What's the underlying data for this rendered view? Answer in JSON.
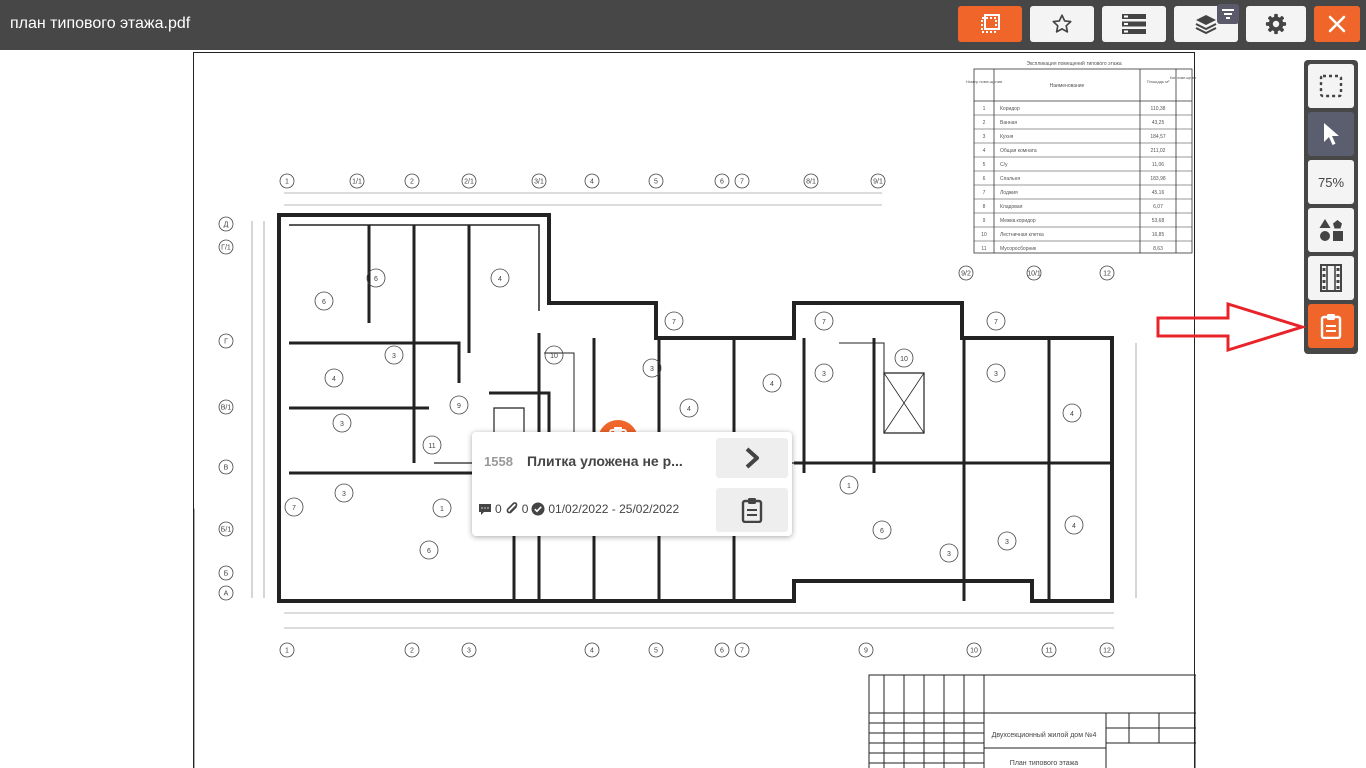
{
  "header": {
    "title": "план типового этажа.pdf"
  },
  "colors": {
    "accent": "#f0652a",
    "toolbar": "#474747",
    "active_tool": "#5b5e6e",
    "annotation_arrow": "#e8242a"
  },
  "toolbar": {
    "buttons": [
      "select-area-icon",
      "star-icon",
      "list-icon",
      "layers-icon",
      "gear-icon",
      "close-icon"
    ],
    "filter_badge": "filter-icon"
  },
  "side_toolbar": {
    "zoom_label": "75%",
    "tools": [
      "select-area-icon",
      "pointer-icon",
      "zoom",
      "shapes-icon",
      "film-icon",
      "clipboard-icon"
    ]
  },
  "task_popup": {
    "number": "1558",
    "title": "Плитка уложена не р...",
    "comments": "0",
    "attachments": "0",
    "dates": "01/02/2022 - 25/02/2022"
  },
  "drawing": {
    "explication_title": "Экспликация помещений типового этажа",
    "table_header": [
      "Номер поме-щения",
      "Наименование",
      "Площадь м²",
      "Кат. поме-ще-ния"
    ],
    "table_rows": [
      [
        "1",
        "Коридор",
        "110,38"
      ],
      [
        "2",
        "Ванная",
        "43,25"
      ],
      [
        "3",
        "Кухня",
        "184,57"
      ],
      [
        "4",
        "Общая комната",
        "211,02"
      ],
      [
        "5",
        "С/у",
        "11,06"
      ],
      [
        "6",
        "Спальня",
        "183,98"
      ],
      [
        "7",
        "Лоджия",
        "45,16"
      ],
      [
        "8",
        "Кладовая",
        "6,07"
      ],
      [
        "9",
        "Межкв.коридор",
        "53,68"
      ],
      [
        "10",
        "Лестничная клетка",
        "16,85"
      ],
      [
        "11",
        "Мусоросборник",
        "8,63"
      ]
    ],
    "axis_top": [
      "1",
      "1/1",
      "2",
      "2/1",
      "3/1",
      "4",
      "5",
      "6",
      "7",
      "8/1",
      "9/1"
    ],
    "axis_right": [
      "9/2",
      "10/1",
      "12"
    ],
    "axis_bottom": [
      "1",
      "2",
      "3",
      "4",
      "5",
      "6",
      "7",
      "9",
      "10",
      "11",
      "12"
    ],
    "axis_left": [
      "Д",
      "Г/1",
      "Г",
      "В/1",
      "В",
      "Б/1",
      "Б",
      "А"
    ],
    "stamp_title": "Двухсекционный жилой дом №4",
    "stamp_subtitle": "План типового этажа"
  }
}
